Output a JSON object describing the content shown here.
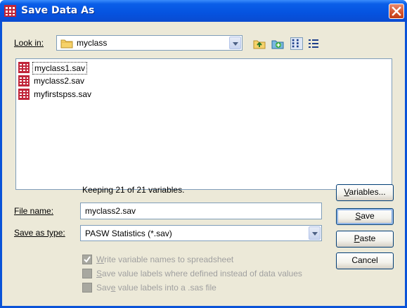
{
  "window": {
    "title": "Save Data As"
  },
  "look_in": {
    "label": "Look in:",
    "value": "myclass"
  },
  "toolbar_icons": [
    "up-folder-icon",
    "new-folder-icon",
    "list-view-icon",
    "details-view-icon"
  ],
  "files": [
    {
      "name": "myclass1.sav",
      "selected": true
    },
    {
      "name": "myclass2.sav",
      "selected": false
    },
    {
      "name": "myfirstspss.sav",
      "selected": false
    }
  ],
  "keeping_text": "Keeping 21 of 21 variables.",
  "file_name": {
    "label": "File name:",
    "value": "myclass2.sav"
  },
  "save_type": {
    "label": "Save as type:",
    "value": "PASW Statistics (*.sav)"
  },
  "options": {
    "write_names": {
      "prefix": "",
      "key": "W",
      "rest": "rite variable names to spreadsheet",
      "checked": true
    },
    "value_labels": {
      "prefix": "",
      "key": "S",
      "rest": "ave value labels where defined instead of data values",
      "checked": false
    },
    "sas_labels": {
      "prefix": "Sav",
      "key": "e",
      "rest": " value labels into a .sas file",
      "checked": false
    }
  },
  "buttons": {
    "variables": {
      "key": "V",
      "rest": "ariables..."
    },
    "save": {
      "key": "S",
      "rest": "ave"
    },
    "paste": {
      "key": "P",
      "rest": "aste"
    },
    "cancel": {
      "label": "Cancel"
    }
  },
  "colors": {
    "titlebar": "#0553e0",
    "dialog_bg": "#ece9d8",
    "close": "#d4522c",
    "folder": "#f6d26a",
    "sav_icon": "#c0263a"
  }
}
